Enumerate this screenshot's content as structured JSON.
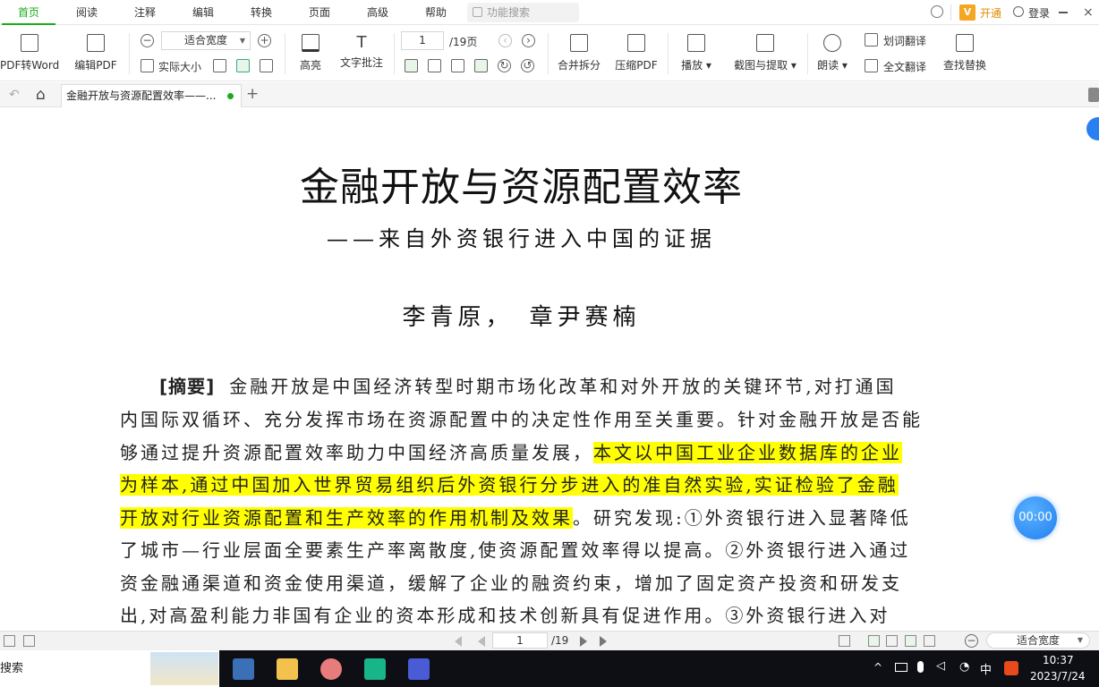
{
  "menu": {
    "tabs": [
      "首页",
      "阅读",
      "注释",
      "编辑",
      "转换",
      "页面",
      "高级",
      "帮助"
    ],
    "search_placeholder": "功能搜索",
    "vip_label": "开通",
    "login_label": "登录"
  },
  "toolbar": {
    "pdf_to_word": "PDF转Word",
    "edit_pdf": "编辑PDF",
    "zoom_value": "适合宽度",
    "actual_size": "实际大小",
    "highlight": "高亮",
    "text_note": "文字批注",
    "page_input": "1",
    "page_total": "/19页",
    "merge_split": "合并拆分",
    "compress": "压缩PDF",
    "play": "播放",
    "screenshot_extract": "截图与提取",
    "read_aloud": "朗读",
    "word_translate": "划词翻译",
    "full_translate": "全文翻译",
    "find_replace": "查找替换"
  },
  "tabs": {
    "doc_tab_title": "金融开放与资源配置效率——..."
  },
  "document": {
    "title": "金融开放与资源配置效率",
    "subtitle": "——来自外资银行进入中国的证据",
    "authors": "李青原，　章尹赛楠",
    "abstract_label": "[摘要]",
    "lines": [
      {
        "pre": "金融开放是中国经济转型时期市场化改革和对外开放的关键环节,对打通国",
        "hl": "",
        "post": ""
      },
      {
        "pre": "内国际双循环、充分发挥市场在资源配置中的决定性作用至关重要。针对金融开放是否能",
        "hl": "",
        "post": ""
      },
      {
        "pre": "够通过提升资源配置效率助力中国经济高质量发展，",
        "hl": "本文以中国工业企业数据库的企业",
        "post": ""
      },
      {
        "pre": "",
        "hl": "为样本,通过中国加入世界贸易组织后外资银行分步进入的准自然实验,实证检验了金融",
        "post": ""
      },
      {
        "pre": "",
        "hl": "开放对行业资源配置和生产效率的作用机制及效果",
        "post": "。研究发现:①外资银行进入显著降低"
      },
      {
        "pre": "了城市—行业层面全要素生产率离散度,使资源配置效率得以提高。②外资银行进入通过",
        "hl": "",
        "post": ""
      },
      {
        "pre": "资金融通渠道和资金使用渠道，缓解了企业的融资约束，增加了固定资产投资和研发支",
        "hl": "",
        "post": ""
      },
      {
        "pre": "出,对高盈利能力非国有企业的资本形成和技术创新具有促进作用。③外资银行进入对",
        "hl": "",
        "post": ""
      }
    ]
  },
  "timer": "00:00",
  "statusbar": {
    "page_input": "1",
    "page_total": "/19",
    "zoom_value": "适合宽度"
  },
  "taskbar": {
    "search_label": "搜索",
    "ime": "中",
    "time": "10:37",
    "date": "2023/7/24"
  },
  "colors": {
    "accent": "#1aad19",
    "highlight": "#ffff00",
    "timer": "#2a86f5"
  }
}
